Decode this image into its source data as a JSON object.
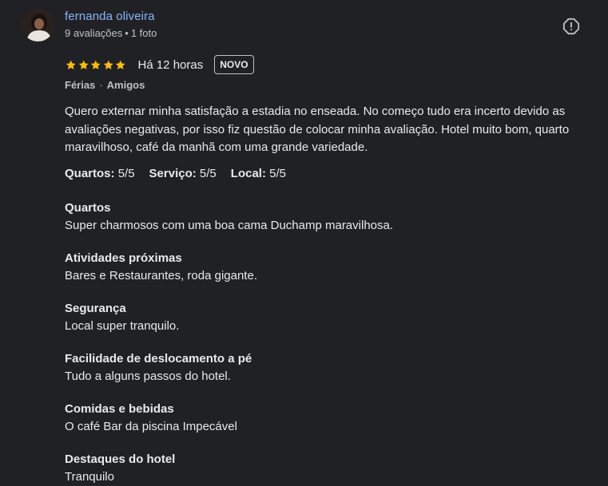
{
  "author": {
    "name": "fernanda oliveira",
    "review_count": "9 avaliações",
    "separator": "•",
    "photo_count": "1 foto"
  },
  "rating": {
    "stars": 5,
    "max_stars": 5,
    "star_color": "#fbbc04",
    "time_ago": "Há 12 horas",
    "badge": "NOVO"
  },
  "trip": {
    "type": "Férias",
    "separator": "·",
    "companions": "Amigos"
  },
  "review_text": "Quero externar minha satisfação a estadia no enseada. No começo tudo era incerto devido as avaliações negativas, por isso fiz questão de colocar minha avaliação. Hotel muito bom, quarto maravilhoso, café da manhã com uma grande variedade.",
  "scores": [
    {
      "label": "Quartos:",
      "value": "5/5"
    },
    {
      "label": "Serviço:",
      "value": "5/5"
    },
    {
      "label": "Local:",
      "value": "5/5"
    }
  ],
  "sections": [
    {
      "heading": "Quartos",
      "text": "Super charmosos com uma boa cama Duchamp maravilhosa."
    },
    {
      "heading": "Atividades próximas",
      "text": "Bares e Restaurantes, roda gigante."
    },
    {
      "heading": "Segurança",
      "text": "Local super tranquilo."
    },
    {
      "heading": "Facilidade de deslocamento a pé",
      "text": "Tudo a alguns passos do hotel."
    },
    {
      "heading": "Comidas e bebidas",
      "text": "O café Bar da piscina Impecável"
    },
    {
      "heading": "Destaques do hotel",
      "text": "Tranquilo"
    }
  ],
  "icons": {
    "report": "report-icon",
    "star": "star-icon"
  },
  "colors": {
    "background": "#202124",
    "link": "#8ab4f8",
    "text": "#e8eaed",
    "secondary": "#bdc1c6"
  }
}
